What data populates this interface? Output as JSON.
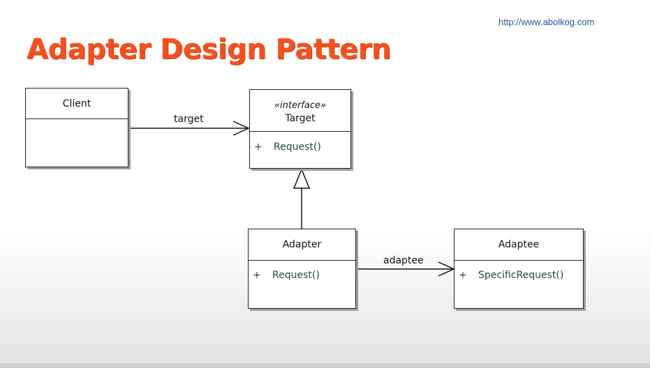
{
  "url": "http://www.abolkog.com",
  "title": "Adapter Design Pattern",
  "classes": {
    "client": {
      "name": "Client"
    },
    "target": {
      "stereotype": "«interface»",
      "name": "Target",
      "operation": "Request()",
      "visibility": "+"
    },
    "adapter": {
      "name": "Adapter",
      "operation": "Request()",
      "visibility": "+"
    },
    "adaptee": {
      "name": "Adaptee",
      "operation": "SpecificRequest()",
      "visibility": "+"
    }
  },
  "relations": {
    "client_target": "target",
    "adapter_adaptee": "adaptee"
  },
  "colors": {
    "title": "#f4511e",
    "url": "#2a4fa8",
    "operation": "#1f4a3e"
  }
}
